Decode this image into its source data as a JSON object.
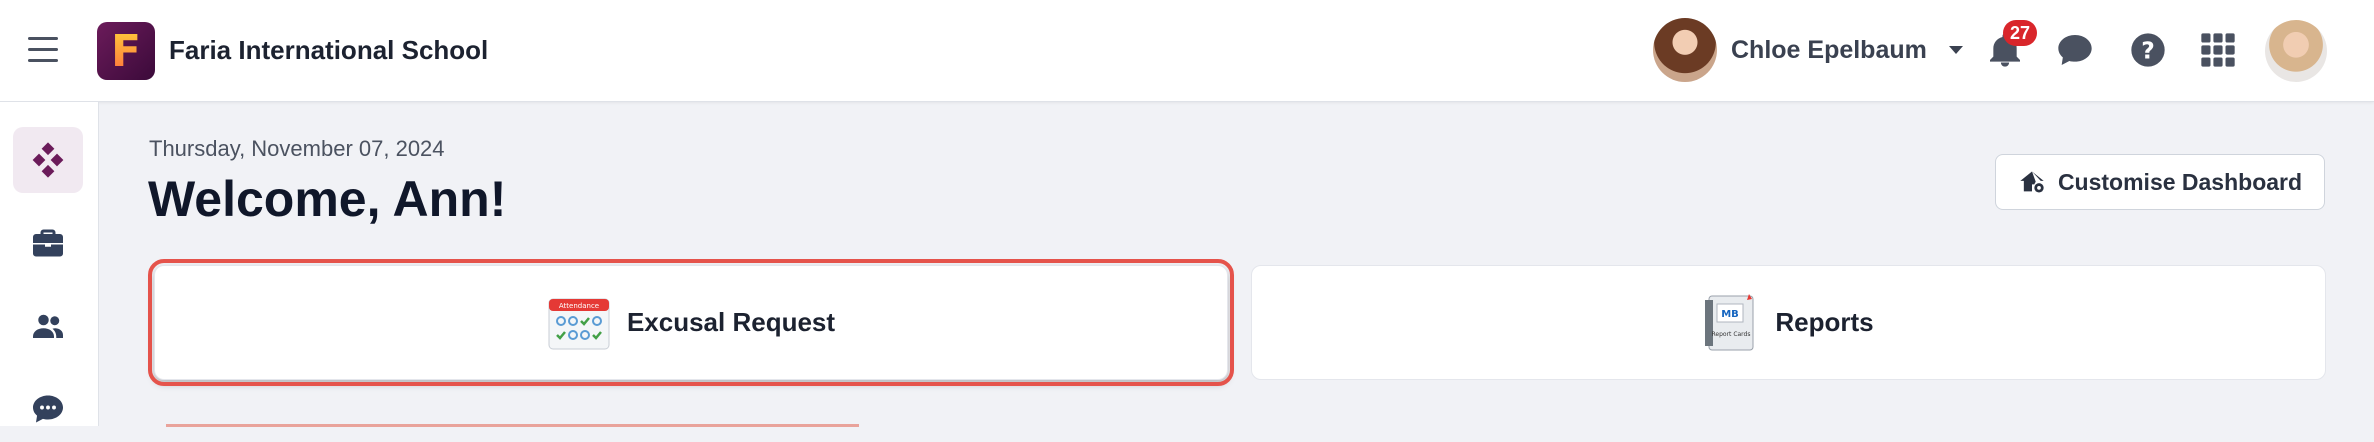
{
  "header": {
    "logo_letter": "F",
    "school_name": "Faria International School",
    "user_name": "Chloe Epelbaum",
    "notifications_count": "27",
    "icons": [
      "menu-icon",
      "bell-icon",
      "chat-icon",
      "help-icon",
      "apps-grid-icon"
    ]
  },
  "sidebar": {
    "items": [
      {
        "icon": "dashboard-icon",
        "active": true
      },
      {
        "icon": "briefcase-icon",
        "active": false
      },
      {
        "icon": "people-icon",
        "active": false
      },
      {
        "icon": "chat-icon",
        "active": false
      }
    ]
  },
  "main": {
    "date": "Thursday, November 07, 2024",
    "welcome": "Welcome, Ann!",
    "customise_label": "Customise Dashboard",
    "cards": [
      {
        "label": "Excusal Request",
        "icon": "attendance-calendar-icon",
        "icon_text": "Attendance"
      },
      {
        "label": "Reports",
        "icon": "report-cards-icon",
        "icon_text_1": "MB",
        "icon_text_2": "Report Cards"
      }
    ]
  },
  "colors": {
    "accent": "#6b1b5a",
    "highlight": "#e5534b",
    "badge": "#d9262b"
  }
}
